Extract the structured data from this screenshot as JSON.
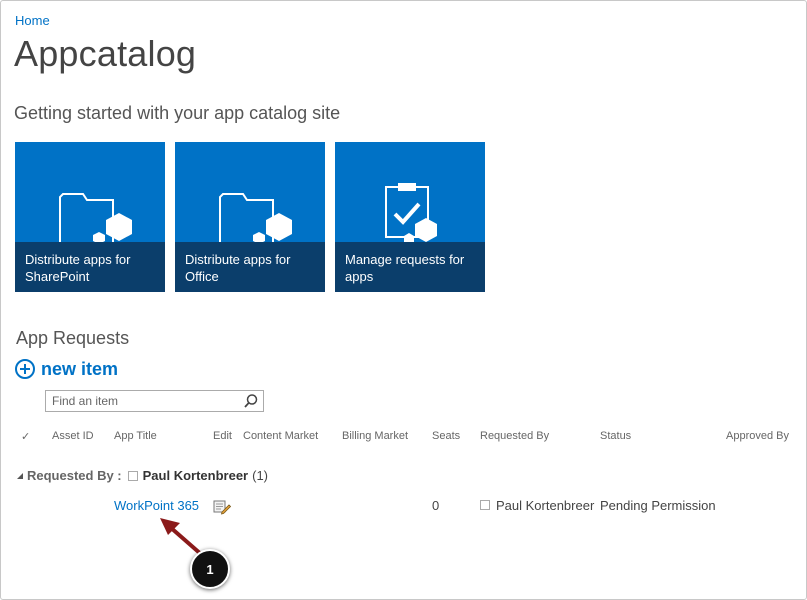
{
  "breadcrumb": "Home",
  "page_title": "Appcatalog",
  "subtitle": "Getting started with your app catalog site",
  "tiles": [
    {
      "label": "Distribute apps for SharePoint",
      "icon": "folder-app-icon"
    },
    {
      "label": "Distribute apps for Office",
      "icon": "folder-app-icon"
    },
    {
      "label": "Manage requests for apps",
      "icon": "clipboard-check-icon"
    }
  ],
  "list": {
    "title": "App Requests",
    "new_item_label": "new item",
    "search_placeholder": "Find an item",
    "columns": {
      "check": "✓",
      "asset_id": "Asset ID",
      "app_title": "App Title",
      "edit": "Edit",
      "content_market": "Content Market",
      "billing_market": "Billing Market",
      "seats": "Seats",
      "requested_by": "Requested By",
      "status": "Status",
      "approved_by": "Approved By"
    },
    "group": {
      "key": "Requested By :",
      "value": "Paul Kortenbreer",
      "count": "(1)"
    },
    "rows": [
      {
        "app_title": "WorkPoint 365",
        "seats": "0",
        "requested_by": "Paul Kortenbreer",
        "status": "Pending Permission"
      }
    ]
  },
  "callout": "1",
  "colors": {
    "accent": "#0072c6",
    "tile_caption": "#0b3e6b",
    "arrow": "#8b1a1a"
  }
}
